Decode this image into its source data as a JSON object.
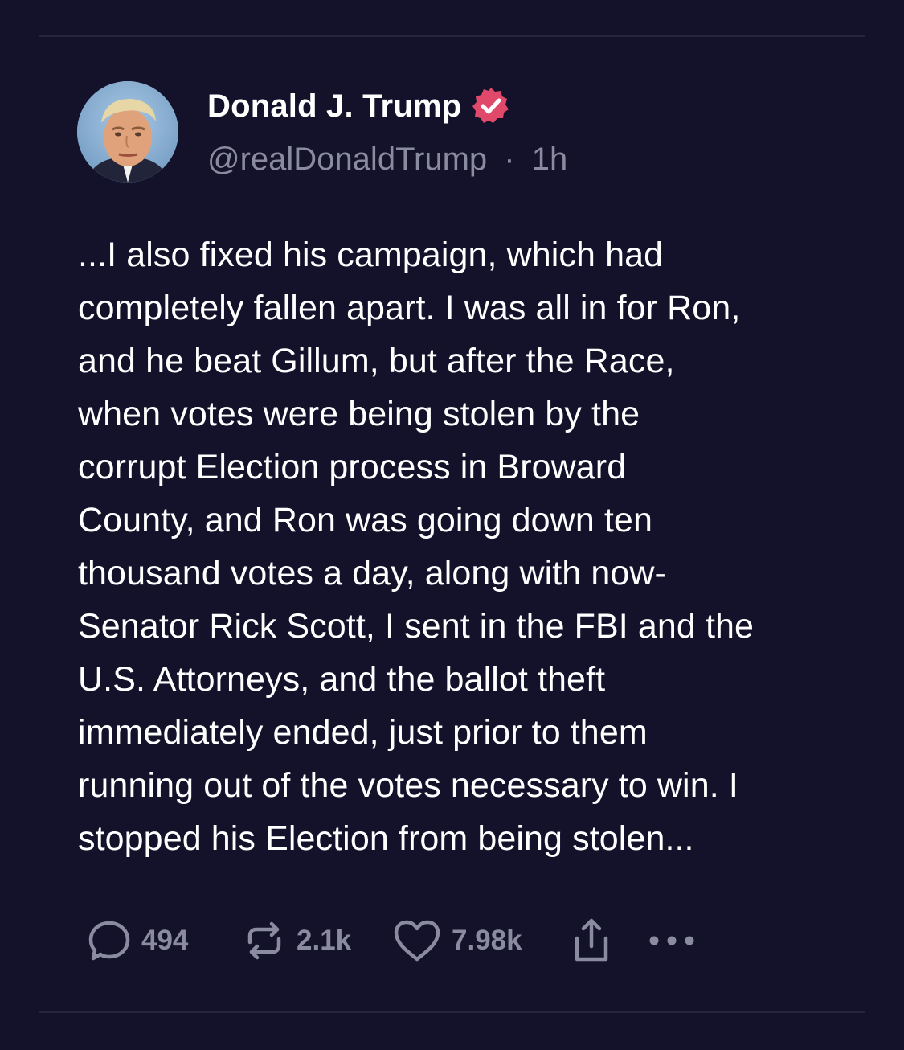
{
  "post": {
    "author": {
      "display_name": "Donald J. Trump",
      "handle": "@realDonaldTrump",
      "separator": "·",
      "time": "1h",
      "verified": true
    },
    "body_lines": [
      "...I also fixed his campaign, which had",
      "completely fallen apart. I was all in for Ron,",
      "and he beat Gillum, but after the Race,",
      "when votes were being stolen by the",
      "corrupt Election process in Broward",
      "County, and Ron was going down ten",
      "thousand votes a day, along with now-",
      "Senator Rick Scott, I sent in the FBI and the",
      "U.S. Attorneys, and the ballot theft",
      "immediately ended, just prior to them",
      "running out of the votes necessary to win. I",
      "stopped his Election from being stolen..."
    ],
    "actions": {
      "reply": {
        "icon": "reply-icon",
        "count": "494"
      },
      "repost": {
        "icon": "repost-icon",
        "count": "2.1k"
      },
      "like": {
        "icon": "heart-icon",
        "count": "7.98k"
      },
      "share": {
        "icon": "share-icon"
      },
      "more": {
        "icon": "more-icon"
      }
    }
  },
  "colors": {
    "background": "#14122b",
    "text_primary": "#ffffff",
    "text_secondary": "#8a8aa0",
    "divider": "#262440",
    "verified_badge": "#e0496a"
  }
}
